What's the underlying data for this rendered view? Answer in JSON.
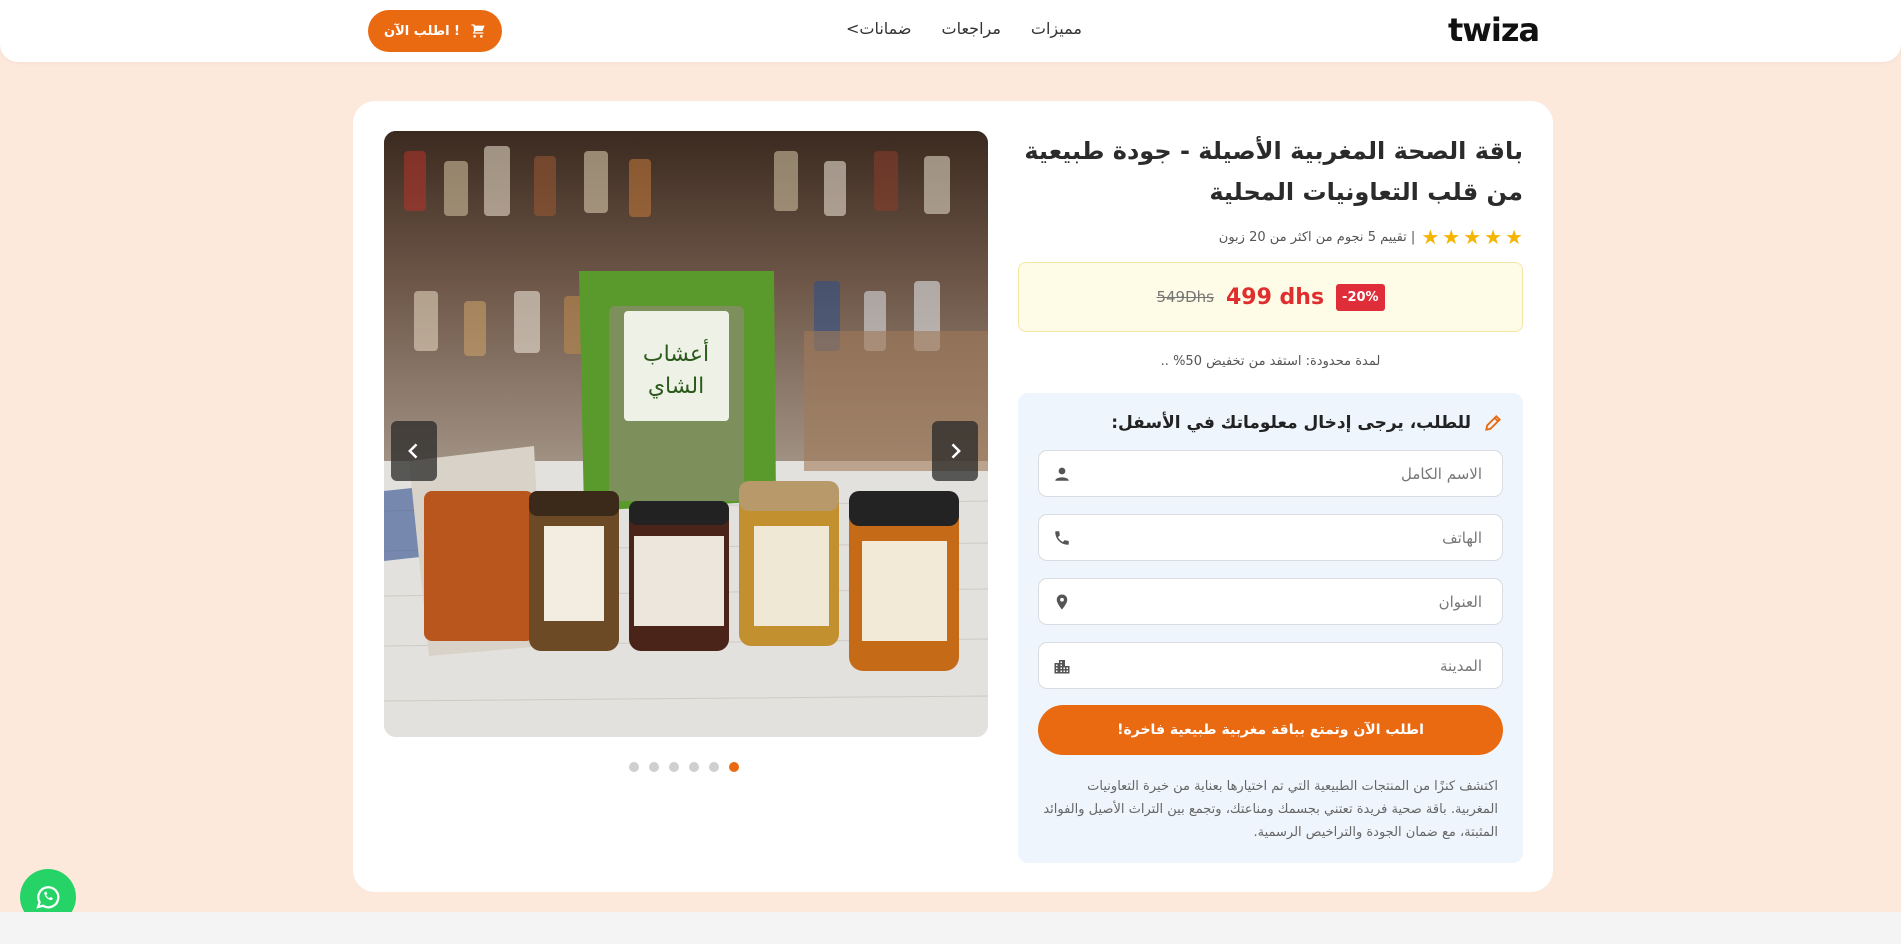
{
  "header": {
    "logo_text": "twiza",
    "nav": [
      "مميزات",
      "مراجعات",
      "ضمانات>"
    ],
    "order_button": "اطلب الآن !"
  },
  "product": {
    "title": "باقة الصحة المغربية الأصيلة - جودة طبيعية من قلب التعاونيات المحلية",
    "rating_text": "| تقييم 5 نجوم من اكثر من 20 زبون",
    "stars": 5,
    "old_price": "549Dhs",
    "new_price": "499 dhs",
    "discount_badge": "-20%",
    "limited_offer": "لمدة محدودة: استفد من تخفيض 50% ..",
    "carousel": {
      "total_slides": 6,
      "active_slide": 1
    }
  },
  "form": {
    "title": "للطلب، يرجى إدخال معلوماتك في الأسفل:",
    "name_placeholder": "الاسم الكامل",
    "phone_placeholder": "الهاتف",
    "address_placeholder": "العنوان",
    "city_placeholder": "المدينة",
    "submit_label": "اطلب الآن وتمتع بباقة مغربية طبيعية فاخرة!",
    "description": "اكتشف كنزًا من المنتجات الطبيعية التي تم اختيارها بعناية من خيرة التعاونيات المغربية. باقة صحية فريدة تعتني بجسمك ومناعتك، وتجمع بين التراث الأصيل والفوائد المثبتة، مع ضمان الجودة والتراخيص الرسمية."
  },
  "colors": {
    "accent": "#ea6a12",
    "page_bg": "#fde8dc",
    "price_red": "#e02d2d",
    "star": "#f4b400",
    "whatsapp": "#25d366"
  }
}
